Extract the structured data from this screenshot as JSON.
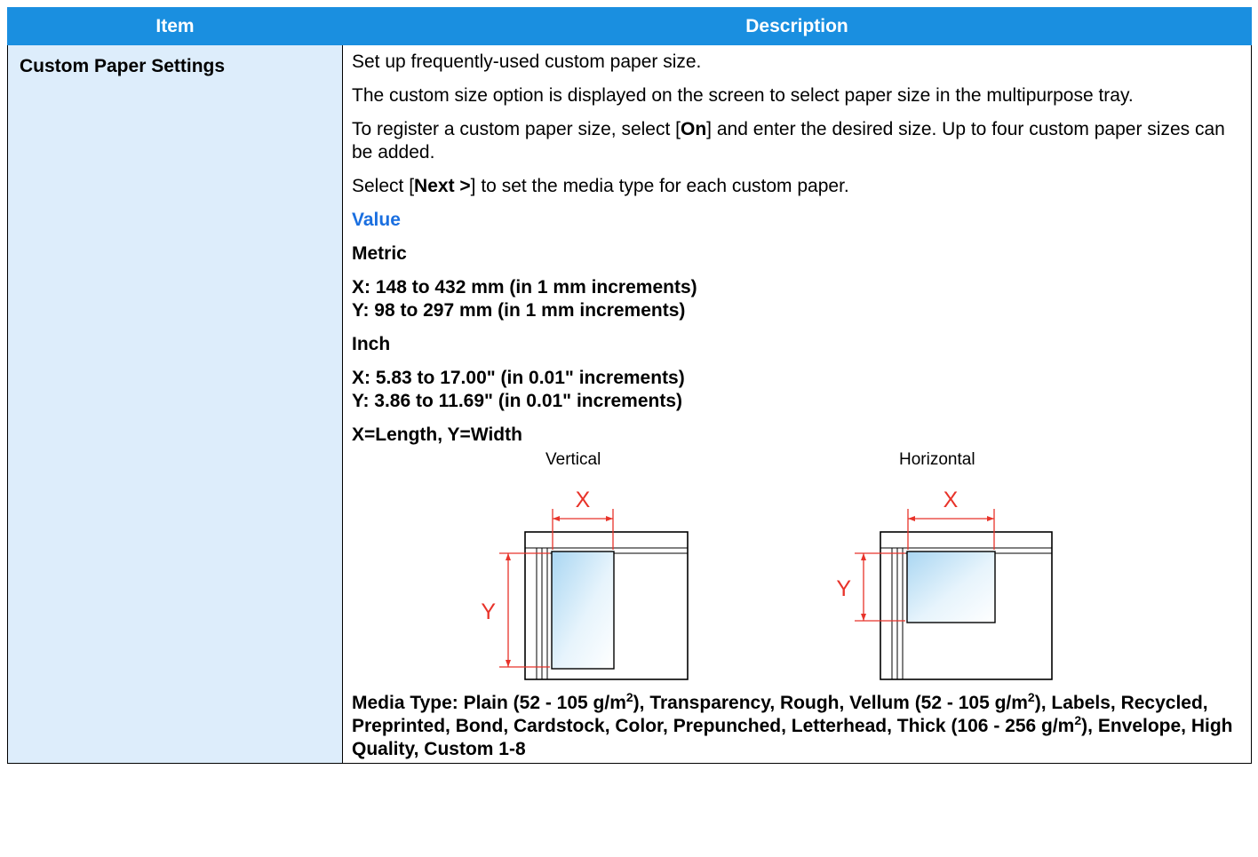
{
  "table": {
    "header_item": "Item",
    "header_description": "Description"
  },
  "row": {
    "item_label": "Custom Paper Settings",
    "desc": {
      "p1": "Set up frequently-used custom paper size.",
      "p2": "The custom size option is displayed on the screen to select paper size in the multipurpose tray.",
      "p3_before": "To register a custom paper size, select [",
      "p3_bold": "On",
      "p3_after": "] and enter the desired size. Up to four custom paper sizes can be added.",
      "p4_before": "Select [",
      "p4_bold": "Next >",
      "p4_after": "] to set the media type for each custom paper.",
      "value_heading": "Value",
      "metric_heading": "Metric",
      "metric_x": "X: 148 to 432 mm (in 1 mm increments)",
      "metric_y": "Y: 98 to 297 mm (in 1 mm increments)",
      "inch_heading": "Inch",
      "inch_x": "X: 5.83 to 17.00\" (in 0.01\" increments)",
      "inch_y": "Y: 3.86 to 11.69\" (in 0.01\" increments)",
      "xy_note": "X=Length, Y=Width",
      "diagram_vertical_label": "Vertical",
      "diagram_horizontal_label": "Horizontal",
      "diagram_x": "X",
      "diagram_y": "Y",
      "media_1": "Media Type: Plain (52 - 105 g/m",
      "media_2": "), Transparency, Rough, Vellum (52 - 105 g/m",
      "media_3": "), Labels, Recycled, Preprinted, Bond, Cardstock, Color, Prepunched, Letterhead, Thick (106 - 256 g/m",
      "media_4": "), Envelope, High Quality, Custom 1-8",
      "superscript": "2"
    }
  },
  "colors": {
    "header_blue": "#1a8fe0",
    "item_cell_bg": "#ddedfb",
    "value_heading": "#1a6fe0",
    "dimension_red": "#e8332a"
  }
}
